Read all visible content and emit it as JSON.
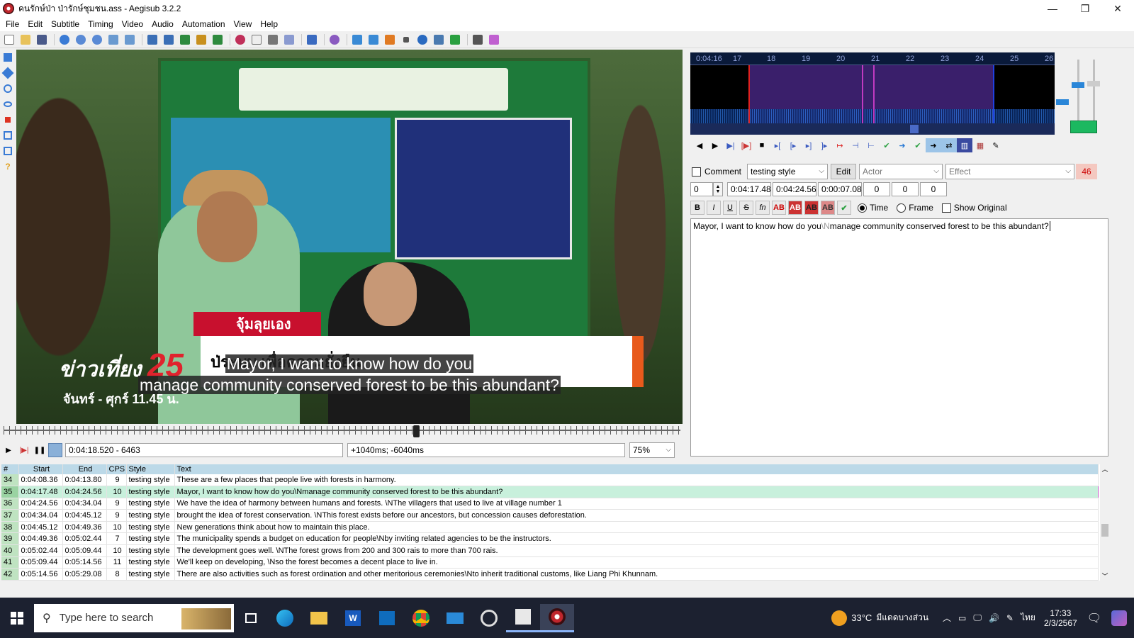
{
  "window": {
    "title": "คนรักษ์ป่า ป่ารักษ์ชุมชน.ass - Aegisub 3.2.2",
    "minimize": "—",
    "maximize": "❐",
    "close": "✕"
  },
  "menu": [
    "File",
    "Edit",
    "Subtitle",
    "Timing",
    "Video",
    "Audio",
    "Automation",
    "View",
    "Help"
  ],
  "video": {
    "subtitle_line1": "Mayor, I want to know how do you",
    "subtitle_line2": "manage community conserved forest to be this abundant?",
    "overlay_name_tag": "จุ้มลุยเอง",
    "overlay_news_brand": "ข่าวเที่ยง",
    "overlay_news_number": "25",
    "overlay_news_time": "จันทร์ - ศุกร์ 11.45 น.",
    "overlay_lower_third": "ป่ระบบ เพื่อความยั่งยืน"
  },
  "video_controls": {
    "time_frame": "0:04:18.520 - 6463",
    "offset": "+1040ms; -6040ms",
    "zoom": "75%"
  },
  "audio": {
    "ruler_start": "0:04:16",
    "ruler_ticks": [
      "17",
      "18",
      "19",
      "20",
      "21",
      "22",
      "23",
      "24",
      "25",
      "26"
    ]
  },
  "edit": {
    "comment_label": "Comment",
    "style": "testing style",
    "edit_button": "Edit",
    "actor_placeholder": "Actor",
    "effect_placeholder": "Effect",
    "char_count": "46",
    "layer": "0",
    "start_time": "0:04:17.48",
    "end_time": "0:04:24.56",
    "duration": "0:00:07.08",
    "margin_l": "0",
    "margin_r": "0",
    "margin_v": "0",
    "format_bold": "B",
    "format_italic": "I",
    "format_underline": "U",
    "format_strike": "S",
    "format_fn": "fn",
    "color_ab": "AB",
    "time_label": "Time",
    "frame_label": "Frame",
    "show_original_label": "Show Original",
    "text_before": "Mayor, I want to know how do you",
    "text_tag": "\\N",
    "text_after": "manage community conserved forest to be this abundant?"
  },
  "grid": {
    "headers": [
      "#",
      "Start",
      "End",
      "CPS",
      "Style",
      "Text"
    ],
    "rows": [
      {
        "num": "34",
        "start": "0:04:08.36",
        "end": "0:04:13.80",
        "cps": "9",
        "style": "testing style",
        "text": "These are a few places that people live with forests in harmony."
      },
      {
        "num": "35",
        "start": "0:04:17.48",
        "end": "0:04:24.56",
        "cps": "10",
        "style": "testing style",
        "text": "Mayor, I want to know how do you\\Nmanage community conserved forest to be this abundant?"
      },
      {
        "num": "36",
        "start": "0:04:24.56",
        "end": "0:04:34.04",
        "cps": "9",
        "style": "testing style",
        "text": "We have the idea of harmony between humans and forests. \\NThe villagers that used to live at village number 1"
      },
      {
        "num": "37",
        "start": "0:04:34.04",
        "end": "0:04:45.12",
        "cps": "9",
        "style": "testing style",
        "text": "brought the idea of forest conservation. \\NThis forest exists before our ancestors, but concession causes deforestation."
      },
      {
        "num": "38",
        "start": "0:04:45.12",
        "end": "0:04:49.36",
        "cps": "10",
        "style": "testing style",
        "text": "New generations think about how to maintain this place."
      },
      {
        "num": "39",
        "start": "0:04:49.36",
        "end": "0:05:02.44",
        "cps": "7",
        "style": "testing style",
        "text": "The municipality spends a budget on education for people\\Nby inviting related agencies to be the instructors."
      },
      {
        "num": "40",
        "start": "0:05:02.44",
        "end": "0:05:09.44",
        "cps": "10",
        "style": "testing style",
        "text": "The development goes well. \\NThe forest grows from 200 and 300 rais to more than 700 rais."
      },
      {
        "num": "41",
        "start": "0:05:09.44",
        "end": "0:05:14.56",
        "cps": "11",
        "style": "testing style",
        "text": "We'll keep on developing, \\Nso the forest becomes a decent place to live in."
      },
      {
        "num": "42",
        "start": "0:05:14.56",
        "end": "0:05:29.08",
        "cps": "8",
        "style": "testing style",
        "text": "There are also activities such as forest ordination and other meritorious ceremonies\\Nto inherit traditional customs, like Liang Phi Khunnam."
      }
    ],
    "selected_index": 1
  },
  "taskbar": {
    "search_placeholder": "Type here to search",
    "weather_temp": "33°C",
    "weather_desc": "มีแดดบางส่วน",
    "lang": "ไทย",
    "time": "17:33",
    "date": "2/3/2567"
  },
  "colors": {
    "grid_header": "#bcd9e8",
    "grid_selected": "#c8f0dc",
    "grid_number": "#bfe3c1",
    "audio_selection": "#3a1f6b",
    "char_count_bg": "#f4c8c0",
    "taskbar": "#1c2130"
  }
}
